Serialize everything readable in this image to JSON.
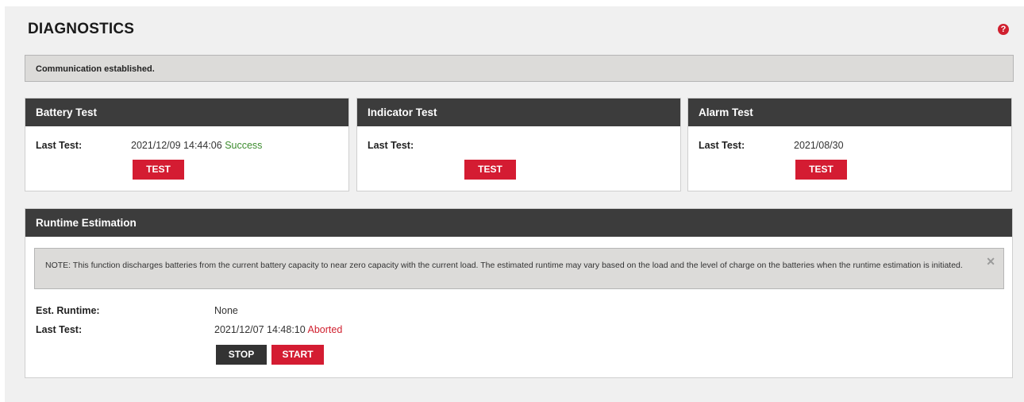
{
  "page": {
    "title": "DIAGNOSTICS",
    "help_icon": "?"
  },
  "status": {
    "message": "Communication established."
  },
  "cards": {
    "battery": {
      "title": "Battery Test",
      "last_test_label": "Last Test:",
      "last_test_time": "2021/12/09 14:44:06",
      "last_test_result": "Success",
      "button": "TEST"
    },
    "indicator": {
      "title": "Indicator Test",
      "last_test_label": "Last Test:",
      "last_test_time": "",
      "button": "TEST"
    },
    "alarm": {
      "title": "Alarm Test",
      "last_test_label": "Last Test:",
      "last_test_time": "2021/08/30",
      "button": "TEST"
    }
  },
  "runtime": {
    "title": "Runtime Estimation",
    "note": "NOTE: This function discharges batteries from the current battery capacity to near zero capacity with the current load. The estimated runtime may vary based on the load and the level of charge on the batteries when the runtime estimation is initiated.",
    "note_close": "✕",
    "est_runtime_label": "Est. Runtime:",
    "est_runtime_value": "None",
    "last_test_label": "Last Test:",
    "last_test_time": "2021/12/07 14:48:10",
    "last_test_result": "Aborted",
    "stop_button": "STOP",
    "start_button": "START"
  },
  "colors": {
    "accent_red": "#d41c32",
    "header_dark": "#3c3c3c",
    "success_green": "#3c8c2e",
    "aborted_red": "#d0202f"
  },
  "icons": {
    "help": "help-circle-icon",
    "close": "close-icon"
  }
}
